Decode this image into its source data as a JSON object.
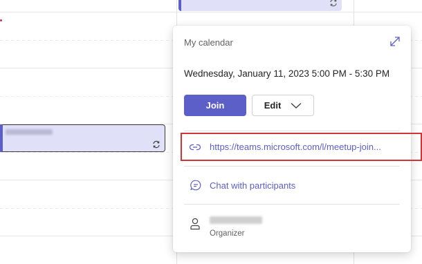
{
  "popup": {
    "calendar_label": "My calendar",
    "datetime": "Wednesday, January 11, 2023 5:00 PM - 5:30 PM",
    "join_label": "Join",
    "edit_label": "Edit",
    "meeting_link": "https://teams.microsoft.com/l/meetup-join...",
    "chat_label": "Chat with participants",
    "organizer_role": "Organizer"
  },
  "icons": {
    "expand": "expand-icon",
    "chevron": "chevron-down-icon",
    "link": "link-icon",
    "chat": "chat-icon",
    "person": "person-icon",
    "recurring": "recurring-icon"
  },
  "colors": {
    "accent": "#5b5fc7",
    "event_fill": "#e0e0f8",
    "highlight_border": "#d13438",
    "time_marker": "#c4314b"
  }
}
